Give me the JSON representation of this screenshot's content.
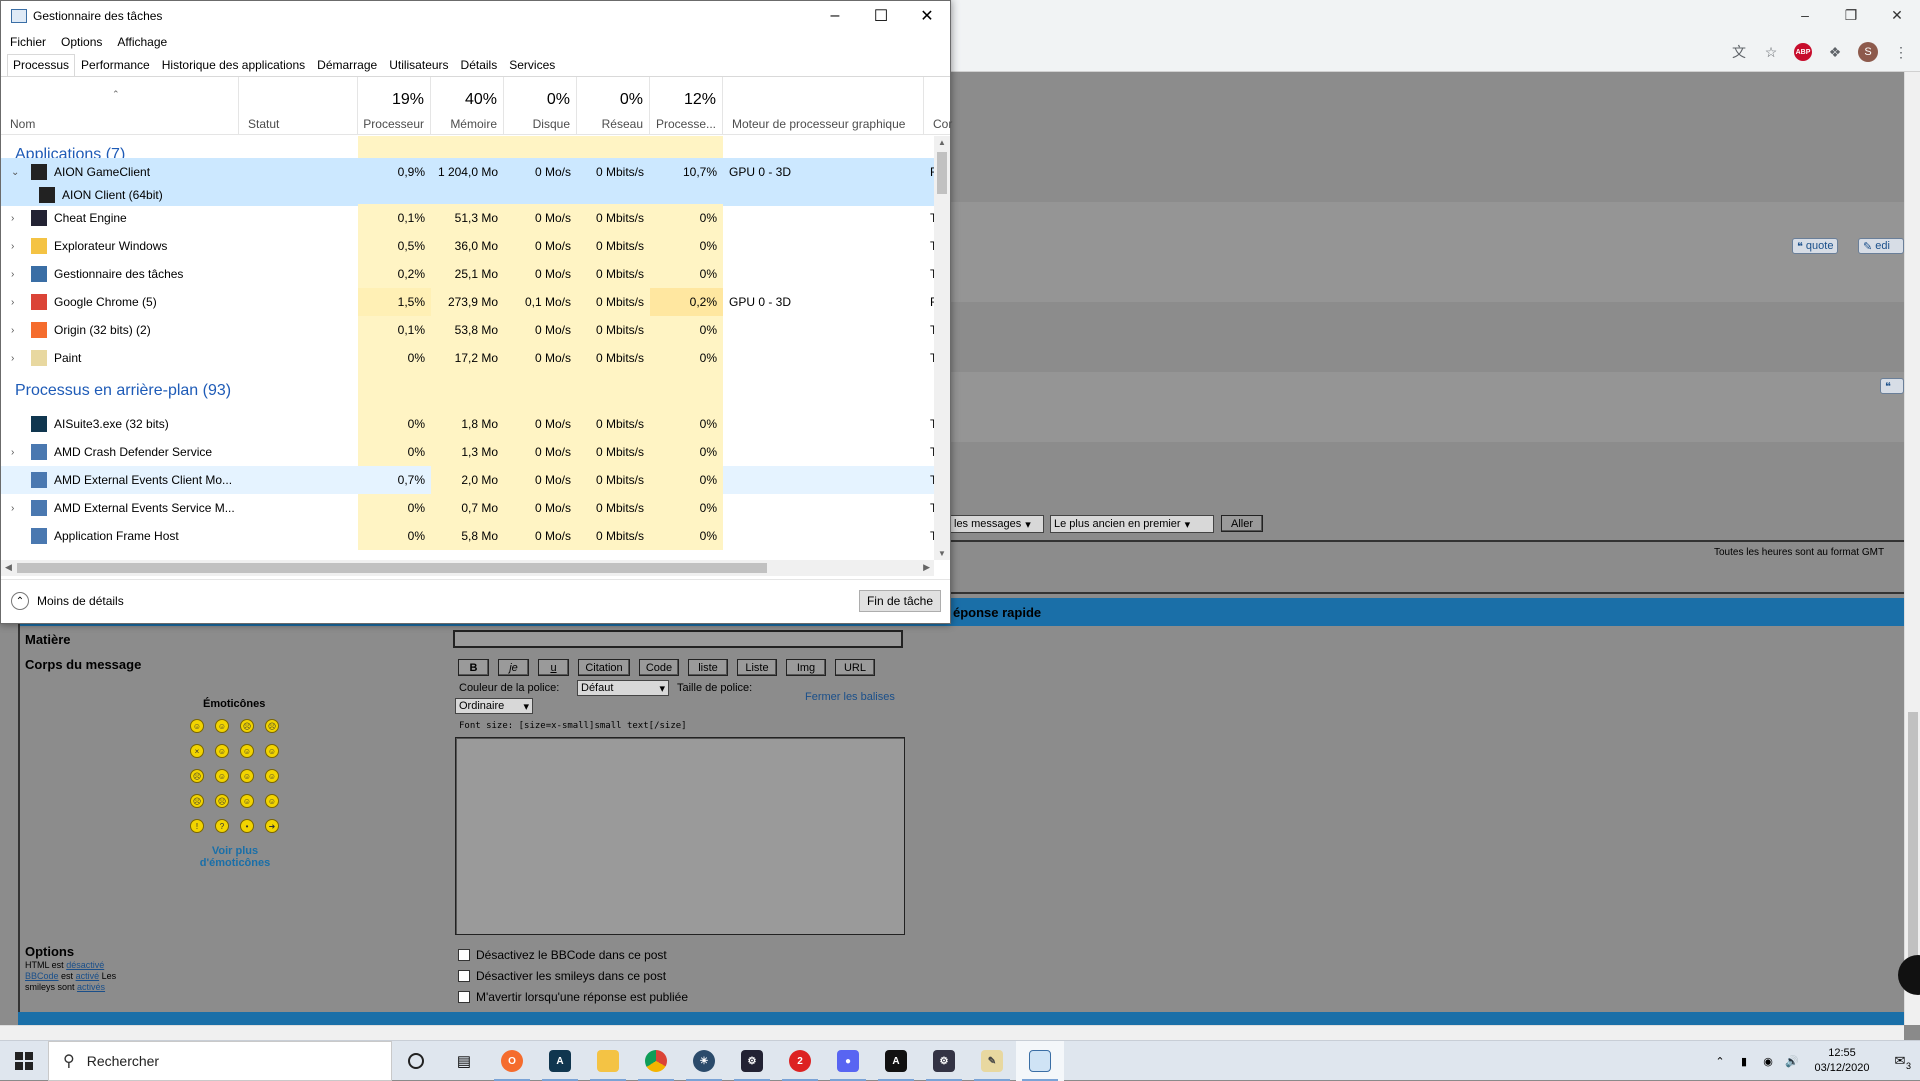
{
  "task_manager": {
    "title": "Gestionnaire des tâches",
    "menu": [
      "Fichier",
      "Options",
      "Affichage"
    ],
    "tabs": [
      "Processus",
      "Performance",
      "Historique des applications",
      "Démarrage",
      "Utilisateurs",
      "Détails",
      "Services"
    ],
    "active_tab": "Processus",
    "columns": {
      "name": "Nom",
      "status": "Statut",
      "cpu": {
        "pct": "19%",
        "label": "Processeur"
      },
      "memory": {
        "pct": "40%",
        "label": "Mémoire"
      },
      "disk": {
        "pct": "0%",
        "label": "Disque"
      },
      "network": {
        "pct": "0%",
        "label": "Réseau"
      },
      "gpu": {
        "pct": "12%",
        "label": "Processe..."
      },
      "gpu_engine": "Moteur de processeur graphique",
      "extra": "Cor"
    },
    "groups": {
      "apps": "Applications (7)",
      "background": "Processus en arrière-plan (93)"
    },
    "rows": [
      {
        "name": "AION GameClient",
        "cpu": "0,9%",
        "mem": "1 204,0 Mo",
        "disk": "0 Mo/s",
        "net": "0 Mbits/s",
        "gpu": "10,7%",
        "engine": "GPU 0 - 3D",
        "extra": "F"
      },
      {
        "name": "AION Client (64bit)",
        "cpu": "",
        "mem": "",
        "disk": "",
        "net": "",
        "gpu": "",
        "engine": "",
        "extra": ""
      },
      {
        "name": "Cheat Engine",
        "cpu": "0,1%",
        "mem": "51,3 Mo",
        "disk": "0 Mo/s",
        "net": "0 Mbits/s",
        "gpu": "0%",
        "engine": "",
        "extra": "T"
      },
      {
        "name": "Explorateur Windows",
        "cpu": "0,5%",
        "mem": "36,0 Mo",
        "disk": "0 Mo/s",
        "net": "0 Mbits/s",
        "gpu": "0%",
        "engine": "",
        "extra": "T"
      },
      {
        "name": "Gestionnaire des tâches",
        "cpu": "0,2%",
        "mem": "25,1 Mo",
        "disk": "0 Mo/s",
        "net": "0 Mbits/s",
        "gpu": "0%",
        "engine": "",
        "extra": "T"
      },
      {
        "name": "Google Chrome (5)",
        "cpu": "1,5%",
        "mem": "273,9 Mo",
        "disk": "0,1 Mo/s",
        "net": "0 Mbits/s",
        "gpu": "0,2%",
        "engine": "GPU 0 - 3D",
        "extra": "F"
      },
      {
        "name": "Origin (32 bits) (2)",
        "cpu": "0,1%",
        "mem": "53,8 Mo",
        "disk": "0 Mo/s",
        "net": "0 Mbits/s",
        "gpu": "0%",
        "engine": "",
        "extra": "T"
      },
      {
        "name": "Paint",
        "cpu": "0%",
        "mem": "17,2 Mo",
        "disk": "0 Mo/s",
        "net": "0 Mbits/s",
        "gpu": "0%",
        "engine": "",
        "extra": "T"
      },
      {
        "name": "AISuite3.exe (32 bits)",
        "cpu": "0%",
        "mem": "1,8 Mo",
        "disk": "0 Mo/s",
        "net": "0 Mbits/s",
        "gpu": "0%",
        "engine": "",
        "extra": "T"
      },
      {
        "name": "AMD Crash Defender Service",
        "cpu": "0%",
        "mem": "1,3 Mo",
        "disk": "0 Mo/s",
        "net": "0 Mbits/s",
        "gpu": "0%",
        "engine": "",
        "extra": "T"
      },
      {
        "name": "AMD External Events Client Mo...",
        "cpu": "0,7%",
        "mem": "2,0 Mo",
        "disk": "0 Mo/s",
        "net": "0 Mbits/s",
        "gpu": "0%",
        "engine": "",
        "extra": "T"
      },
      {
        "name": "AMD External Events Service M...",
        "cpu": "0%",
        "mem": "0,7 Mo",
        "disk": "0 Mo/s",
        "net": "0 Mbits/s",
        "gpu": "0%",
        "engine": "",
        "extra": "T"
      },
      {
        "name": "Application Frame Host",
        "cpu": "0%",
        "mem": "5,8 Mo",
        "disk": "0 Mo/s",
        "net": "0 Mbits/s",
        "gpu": "0%",
        "engine": "",
        "extra": "T"
      }
    ],
    "footer": {
      "less_details": "Moins de détails",
      "end_task": "Fin de tâche"
    }
  },
  "forum": {
    "post_buttons": {
      "quote": "quote",
      "edit": "edi"
    },
    "select_messages": "les messages",
    "select_order": "Le plus ancien en premier",
    "go_button": "Aller",
    "timezone_note": "Toutes les heures sont au format GMT",
    "quick_reply_title": "éponse rapide",
    "subject_label": "Matière",
    "body_label": "Corps du message",
    "emoticons_title": "Émoticônes",
    "more_emoticons": "Voir plus d'émoticônes",
    "bbcode_buttons": [
      "B",
      "je",
      "u",
      "Citation",
      "Code",
      "liste",
      "Liste",
      "Img",
      "URL"
    ],
    "font_color_label": "Couleur de la police:",
    "font_color_value": "Défaut",
    "font_size_label": "Taille de police:",
    "font_size_value": "Ordinaire",
    "close_tags": "Fermer les balises",
    "font_size_hint": "Font size: [size=x-small]small text[/size]",
    "options_label": "Options",
    "options_html_prefix": "HTML est",
    "options_html_state": "désactivé",
    "options_bbcode_link": "BBCode",
    "options_bbcode_mid": "est",
    "options_bbcode_state": "activé",
    "options_smileys_a": "Les",
    "options_smileys_b": "smileys sont",
    "options_smileys_state": "activés",
    "checkboxes": [
      "Désactivez le BBCode dans ce post",
      "Désactiver les smileys dans ce post",
      "M'avertir lorsqu'une réponse est publiée"
    ]
  },
  "taskbar": {
    "search_placeholder": "Rechercher",
    "time": "12:55",
    "date": "03/12/2020",
    "notification_count": "3",
    "apps": [
      "origin-icon",
      "aisuite-icon",
      "file-explorer-icon",
      "chrome-icon",
      "origin-launcher-icon",
      "cheat-engine-icon",
      "red-app-icon",
      "discord-icon",
      "aion-icon",
      "cheat-engine-2-icon",
      "paint-icon",
      "task-manager-icon"
    ]
  },
  "colors": {
    "accent_blue": "#1a6fa8",
    "heat_yellow": "#fff4c4",
    "selection": "#cce8ff",
    "group_blue": "#1e5bb7"
  }
}
